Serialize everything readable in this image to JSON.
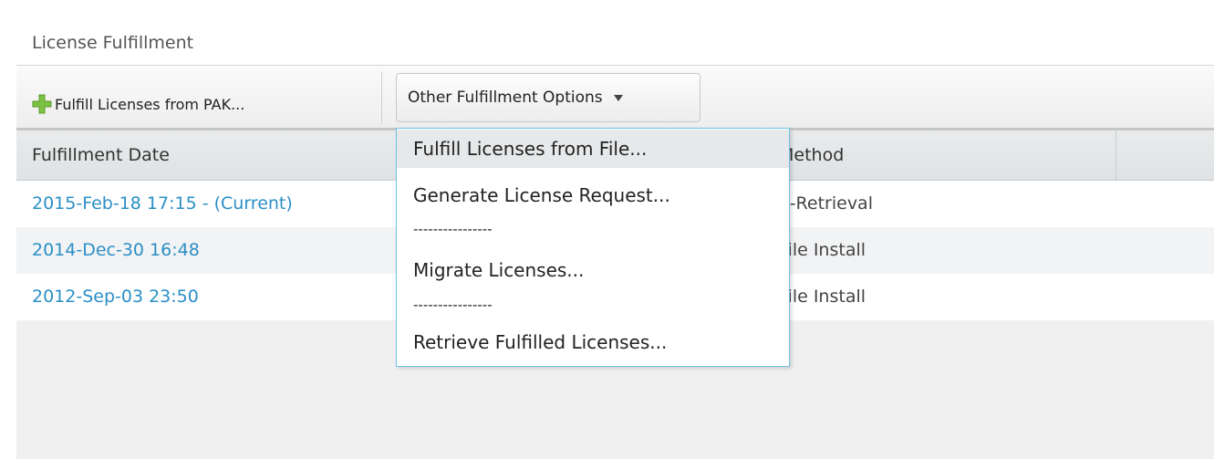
{
  "section": {
    "title": "License Fulfillment"
  },
  "toolbar": {
    "pak_label": "Fulfill Licenses from PAK...",
    "pak_icon": "plus-icon",
    "other_label": "Other Fulfillment Options",
    "other_icon": "caret-down-icon"
  },
  "grid": {
    "columns": [
      "Fulfillment Date",
      "Method"
    ],
    "rows": [
      {
        "date": "2015-Feb-18 17:15 - (Current)",
        "method": "e-Retrieval"
      },
      {
        "date": "2014-Dec-30 16:48",
        "method": "File Install"
      },
      {
        "date": "2012-Sep-03 23:50",
        "method": "File Install"
      }
    ]
  },
  "dropdown": {
    "items": [
      "Fulfill Licenses from File...",
      "Generate License Request...",
      "----------------",
      "Migrate Licenses...",
      "----------------",
      "Retrieve Fulfilled Licenses..."
    ]
  },
  "colors": {
    "link": "#2b8fc6",
    "plus_icon": "#7cc242",
    "dropdown_border": "#6ec3e6"
  }
}
